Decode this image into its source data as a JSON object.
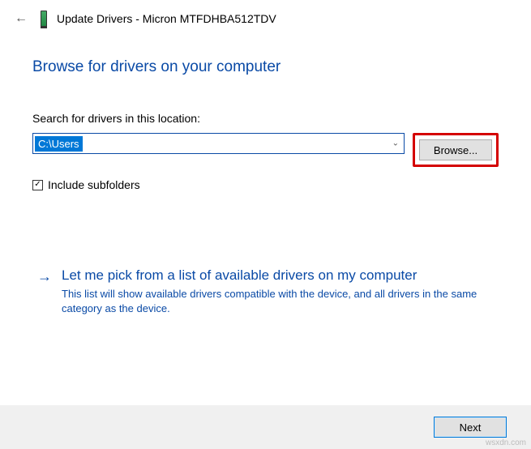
{
  "header": {
    "title": "Update Drivers - Micron MTFDHBA512TDV"
  },
  "main": {
    "heading": "Browse for drivers on your computer",
    "search_label": "Search for drivers in this location:",
    "path_value": "C:\\Users",
    "browse_label": "Browse...",
    "include_subfolders_label": "Include subfolders",
    "include_subfolders_checked": "☑"
  },
  "pick": {
    "title": "Let me pick from a list of available drivers on my computer",
    "desc": "This list will show available drivers compatible with the device, and all drivers in the same category as the device."
  },
  "footer": {
    "next_label": "Next"
  },
  "watermark": "wsxdn.com"
}
